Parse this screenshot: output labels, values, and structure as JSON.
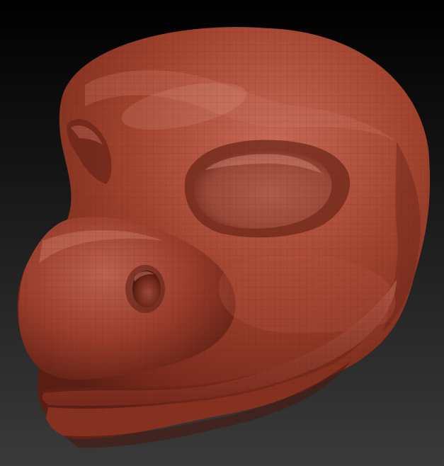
{
  "scene": {
    "subject": "sculpted-creature-head",
    "colors": {
      "background_top": "#000000",
      "background_bottom": "#3a3a3a",
      "clay_base": "#9a3c2c",
      "clay_light": "#c86a58",
      "clay_dark": "#5a1e14",
      "clay_shadow": "#3c120c",
      "wireframe": "#4a1a12"
    }
  }
}
